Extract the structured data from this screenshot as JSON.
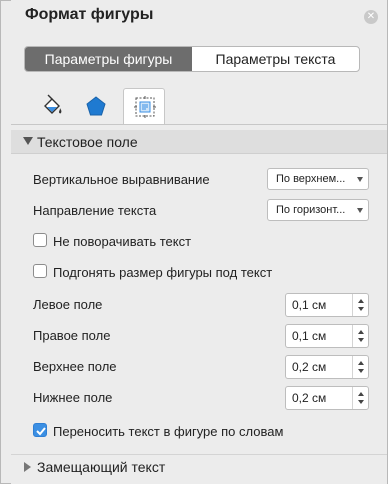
{
  "panel": {
    "title": "Формат фигуры",
    "close_icon": "close-icon"
  },
  "segments": [
    {
      "label": "Параметры фигуры",
      "active": true
    },
    {
      "label": "Параметры текста",
      "active": false
    }
  ],
  "tabs": [
    {
      "icon": "fill-bucket-icon",
      "selected": false
    },
    {
      "icon": "pentagon-icon",
      "selected": false
    },
    {
      "icon": "text-box-layout-icon",
      "selected": true
    }
  ],
  "section": {
    "label": "Текстовое поле"
  },
  "fields": {
    "vertical_align_label": "Вертикальное выравнивание",
    "vertical_align_value": "По верхнем...",
    "text_direction_label": "Направление текста",
    "text_direction_value": "По горизонт...",
    "no_rotate_label": "Не поворачивать текст",
    "autofit_label": "Подгонять размер фигуры под текст",
    "left_margin_label": "Левое поле",
    "left_margin_value": "0,1 см",
    "right_margin_label": "Правое поле",
    "right_margin_value": "0,1 см",
    "top_margin_label": "Верхнее поле",
    "top_margin_value": "0,2 см",
    "bottom_margin_label": "Нижнее поле",
    "bottom_margin_value": "0,2 см",
    "wrap_label": "Переносить текст в фигуре по словам"
  },
  "checkboxes": {
    "no_rotate": false,
    "autofit": false,
    "wrap": true
  },
  "footer": {
    "label": "Замещающий текст"
  },
  "colors": {
    "accent": "#3b8fe3",
    "segment_active": "#6d6d6d",
    "pentagon": "#1f7ad1"
  }
}
